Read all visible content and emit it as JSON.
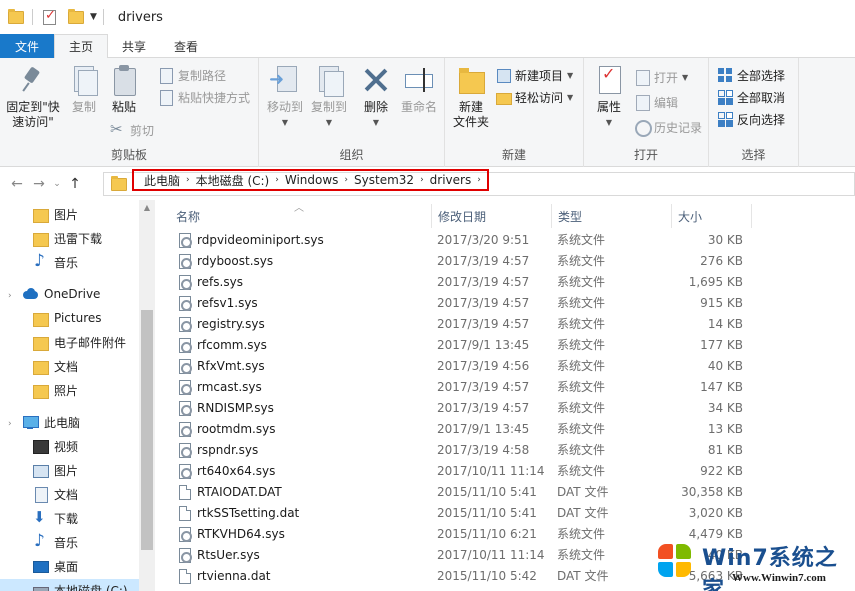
{
  "window": {
    "title": "drivers"
  },
  "tabs": [
    {
      "label": "文件"
    },
    {
      "label": "主页"
    },
    {
      "label": "共享"
    },
    {
      "label": "查看"
    }
  ],
  "ribbon": {
    "clipboard": {
      "label": "剪贴板",
      "pin_line1": "固定到\"快",
      "pin_line2": "速访问\"",
      "copy": "复制",
      "paste": "粘贴",
      "copy_path": "复制路径",
      "paste_shortcut": "粘贴快捷方式",
      "cut": "剪切"
    },
    "organize": {
      "label": "组织",
      "move_to": "移动到",
      "copy_to": "复制到",
      "delete": "删除",
      "rename": "重命名"
    },
    "new": {
      "label": "新建",
      "new_folder_line1": "新建",
      "new_folder_line2": "文件夹",
      "new_item": "新建项目",
      "easy_access": "轻松访问"
    },
    "open": {
      "label": "打开",
      "properties": "属性",
      "open": "打开",
      "edit": "编辑",
      "history": "历史记录"
    },
    "select": {
      "label": "选择",
      "select_all": "全部选择",
      "select_none": "全部取消",
      "invert": "反向选择"
    }
  },
  "address": {
    "crumbs": [
      "此电脑",
      "本地磁盘 (C:)",
      "Windows",
      "System32",
      "drivers"
    ]
  },
  "sidebar": {
    "items": [
      {
        "label": "图片",
        "icon": "folder-icon"
      },
      {
        "label": "迅雷下载",
        "icon": "folder-icon"
      },
      {
        "label": "音乐",
        "icon": "music-icon"
      },
      {
        "label": "OneDrive",
        "icon": "cloud-icon"
      },
      {
        "label": "Pictures",
        "icon": "folder-icon"
      },
      {
        "label": "电子邮件附件",
        "icon": "folder-icon"
      },
      {
        "label": "文档",
        "icon": "folder-icon"
      },
      {
        "label": "照片",
        "icon": "folder-icon"
      },
      {
        "label": "此电脑",
        "icon": "computer-icon"
      },
      {
        "label": "视频",
        "icon": "video-icon"
      },
      {
        "label": "图片",
        "icon": "picture-icon"
      },
      {
        "label": "文档",
        "icon": "document-icon"
      },
      {
        "label": "下载",
        "icon": "download-icon"
      },
      {
        "label": "音乐",
        "icon": "music-icon"
      },
      {
        "label": "桌面",
        "icon": "desktop-icon"
      },
      {
        "label": "本地磁盘 (C:)",
        "icon": "disk-icon"
      }
    ]
  },
  "columns": {
    "name": "名称",
    "date": "修改日期",
    "type": "类型",
    "size": "大小"
  },
  "files": [
    {
      "name": "rdpvideominiport.sys",
      "date": "2017/3/20 9:51",
      "type": "系统文件",
      "size": "30 KB",
      "kind": "sys"
    },
    {
      "name": "rdyboost.sys",
      "date": "2017/3/19 4:57",
      "type": "系统文件",
      "size": "276 KB",
      "kind": "sys"
    },
    {
      "name": "refs.sys",
      "date": "2017/3/19 4:57",
      "type": "系统文件",
      "size": "1,695 KB",
      "kind": "sys"
    },
    {
      "name": "refsv1.sys",
      "date": "2017/3/19 4:57",
      "type": "系统文件",
      "size": "915 KB",
      "kind": "sys"
    },
    {
      "name": "registry.sys",
      "date": "2017/3/19 4:57",
      "type": "系统文件",
      "size": "14 KB",
      "kind": "sys"
    },
    {
      "name": "rfcomm.sys",
      "date": "2017/9/1 13:45",
      "type": "系统文件",
      "size": "177 KB",
      "kind": "sys"
    },
    {
      "name": "RfxVmt.sys",
      "date": "2017/3/19 4:56",
      "type": "系统文件",
      "size": "40 KB",
      "kind": "sys"
    },
    {
      "name": "rmcast.sys",
      "date": "2017/3/19 4:57",
      "type": "系统文件",
      "size": "147 KB",
      "kind": "sys"
    },
    {
      "name": "RNDISMP.sys",
      "date": "2017/3/19 4:57",
      "type": "系统文件",
      "size": "34 KB",
      "kind": "sys"
    },
    {
      "name": "rootmdm.sys",
      "date": "2017/9/1 13:45",
      "type": "系统文件",
      "size": "13 KB",
      "kind": "sys"
    },
    {
      "name": "rspndr.sys",
      "date": "2017/3/19 4:58",
      "type": "系统文件",
      "size": "81 KB",
      "kind": "sys"
    },
    {
      "name": "rt640x64.sys",
      "date": "2017/10/11 11:14",
      "type": "系统文件",
      "size": "922 KB",
      "kind": "sys"
    },
    {
      "name": "RTAIODAT.DAT",
      "date": "2015/11/10 5:41",
      "type": "DAT 文件",
      "size": "30,358 KB",
      "kind": "plain"
    },
    {
      "name": "rtkSSTsetting.dat",
      "date": "2015/11/10 5:41",
      "type": "DAT 文件",
      "size": "3,020 KB",
      "kind": "plain"
    },
    {
      "name": "RTKVHD64.sys",
      "date": "2015/11/10 6:21",
      "type": "系统文件",
      "size": "4,479 KB",
      "kind": "sys"
    },
    {
      "name": "RtsUer.sys",
      "date": "2017/10/11 11:14",
      "type": "系统文件",
      "size": "40 KB",
      "kind": "sys"
    },
    {
      "name": "rtvienna.dat",
      "date": "2015/11/10 5:42",
      "type": "DAT 文件",
      "size": "5,663 KB",
      "kind": "plain"
    }
  ],
  "watermark": {
    "text": "Win7系统之家",
    "url": "Www.Winwin7.com"
  }
}
